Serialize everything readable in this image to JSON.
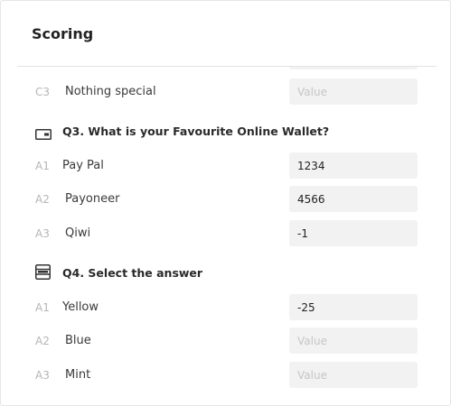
{
  "panel": {
    "title": "Scoring"
  },
  "questions": [
    {
      "answers": [
        {
          "code": "C3",
          "label": "Nothing special",
          "value": "",
          "placeholder": "Value"
        }
      ]
    },
    {
      "title": "Q3. What is your Favourite Online Wallet?",
      "icon": "wallet-card-icon",
      "answers": [
        {
          "code": "A1",
          "label": "Pay Pal",
          "value": "1234",
          "placeholder": "Value"
        },
        {
          "code": "A2",
          "label": "Payoneer",
          "value": "4566",
          "placeholder": "Value"
        },
        {
          "code": "A3",
          "label": "Qiwi",
          "value": "-1",
          "placeholder": "Value"
        }
      ]
    },
    {
      "title": "Q4. Select the answer",
      "icon": "select-list-icon",
      "answers": [
        {
          "code": "A1",
          "label": "Yellow",
          "value": "-25",
          "placeholder": "Value"
        },
        {
          "code": "A2",
          "label": "Blue",
          "value": "",
          "placeholder": "Value"
        },
        {
          "code": "A3",
          "label": "Mint",
          "value": "",
          "placeholder": "Value"
        }
      ]
    }
  ]
}
